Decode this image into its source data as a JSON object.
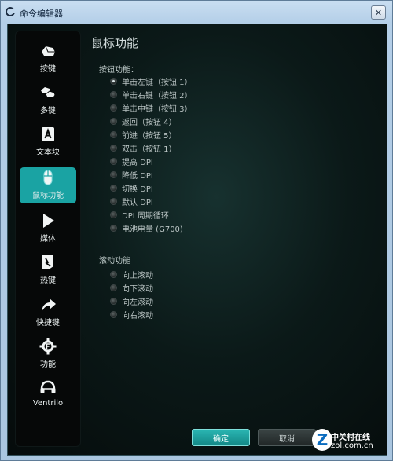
{
  "window": {
    "title": "命令编辑器",
    "close_glyph": "✕"
  },
  "sidebar": {
    "items": [
      {
        "label": "按键",
        "icon": "mouse-button-icon",
        "active": false
      },
      {
        "label": "多键",
        "icon": "multi-key-icon",
        "active": false
      },
      {
        "label": "文本块",
        "icon": "text-block-icon",
        "active": false
      },
      {
        "label": "鼠标功能",
        "icon": "mouse-icon",
        "active": true
      },
      {
        "label": "媒体",
        "icon": "play-icon",
        "active": false
      },
      {
        "label": "热键",
        "icon": "hotkey-icon",
        "active": false
      },
      {
        "label": "快捷键",
        "icon": "shortcut-arrow-icon",
        "active": false
      },
      {
        "label": "功能",
        "icon": "function-gear-icon",
        "active": false
      },
      {
        "label": "Ventrilo",
        "icon": "ventrilo-headset-icon",
        "active": false
      }
    ]
  },
  "main": {
    "title": "鼠标功能",
    "button_section": {
      "title": "按钮功能：",
      "options": [
        {
          "label": "单击左键（按钮 1）",
          "checked": true
        },
        {
          "label": "单击右键（按钮 2）",
          "checked": false
        },
        {
          "label": "单击中键（按钮 3）",
          "checked": false
        },
        {
          "label": "返回（按钮 4）",
          "checked": false
        },
        {
          "label": "前进（按钮 5）",
          "checked": false
        },
        {
          "label": "双击（按钮 1）",
          "checked": false
        },
        {
          "label": "提高 DPI",
          "checked": false
        },
        {
          "label": "降低 DPI",
          "checked": false
        },
        {
          "label": "切换 DPI",
          "checked": false
        },
        {
          "label": "默认 DPI",
          "checked": false
        },
        {
          "label": "DPI 周期循环",
          "checked": false
        },
        {
          "label": "电池电量 (G700)",
          "checked": false
        }
      ]
    },
    "scroll_section": {
      "title": "滚动功能",
      "options": [
        {
          "label": "向上滚动",
          "checked": false
        },
        {
          "label": "向下滚动",
          "checked": false
        },
        {
          "label": "向左滚动",
          "checked": false
        },
        {
          "label": "向右滚动",
          "checked": false
        }
      ]
    }
  },
  "footer": {
    "ok_label": "确定",
    "cancel_label": "取消"
  },
  "watermark": {
    "letter": "Z",
    "name": "中关村在线",
    "url": "zol.com.cn"
  },
  "colors": {
    "accent": "#1aa3a3",
    "background": "#0b1918",
    "sidebar": "#060808"
  }
}
